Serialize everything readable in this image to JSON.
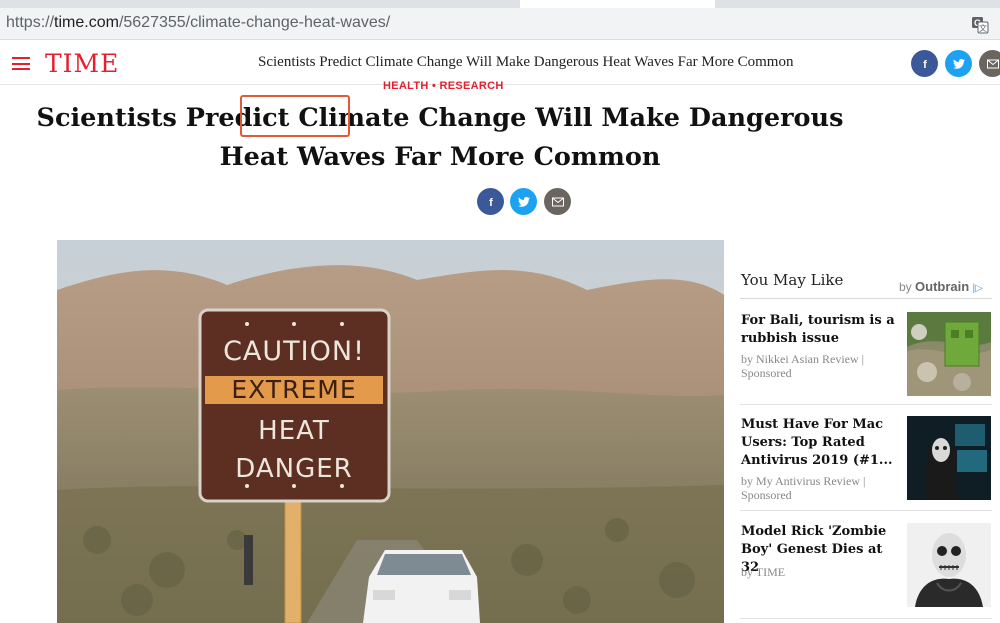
{
  "browser": {
    "url_scheme": "https://",
    "url_host": "time.com",
    "url_path": "/5627355/climate-change-heat-waves/"
  },
  "header": {
    "logo": "TIME",
    "title": "Scientists Predict Climate Change Will Make Dangerous Heat Waves Far More Common"
  },
  "article": {
    "kicker": "HEALTH • RESEARCH",
    "headline_before": "Scientists Predict ",
    "headline_highlight": "Climate",
    "headline_after": " Change Will Make Dangerous Heat Waves Far More Common"
  },
  "hero_sign": {
    "line1": "CAUTION!",
    "line2": "EXTREME",
    "line3": "HEAT",
    "line4": "DANGER"
  },
  "sidebar": {
    "title": "You May Like",
    "by": "by",
    "brand": "Outbrain",
    "ad_marker": "|▷",
    "cards": [
      {
        "title": "For Bali, tourism is a rubbish issue",
        "source": "by Nikkei Asian Review | Sponsored"
      },
      {
        "title": "Must Have For Mac Users: Top Rated Antivirus 2019 (#1...",
        "source": "by My Antivirus Review | Sponsored"
      },
      {
        "title": "Model Rick 'Zombie Boy' Genest Dies at 32",
        "source": "by TIME"
      }
    ]
  },
  "colors": {
    "brand_red": "#e4202e",
    "facebook": "#3b5998",
    "twitter": "#1da1f2",
    "email": "#6b6560",
    "highlight": "#e05a3a"
  },
  "icons": {
    "menu": "menu-icon",
    "translate": "translate-icon",
    "facebook": "facebook-icon",
    "twitter": "twitter-icon",
    "email": "email-icon"
  }
}
